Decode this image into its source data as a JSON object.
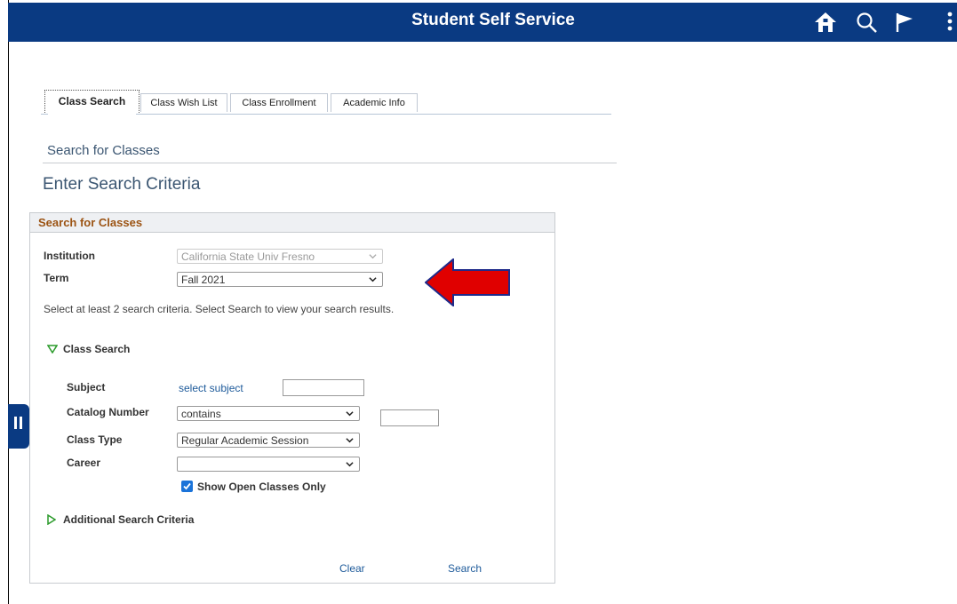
{
  "header": {
    "title": "Student Self Service"
  },
  "icons": {
    "home": "home-icon",
    "search": "search-icon",
    "flag": "flag-icon",
    "menu": "kebab-menu-icon"
  },
  "tabs": [
    {
      "label": "Class Search",
      "active": true
    },
    {
      "label": "Class Wish List",
      "active": false
    },
    {
      "label": "Class Enrollment",
      "active": false
    },
    {
      "label": "Academic Info",
      "active": false
    }
  ],
  "page": {
    "title": "Search for Classes",
    "section_title": "Enter Search Criteria"
  },
  "search_box": {
    "header": "Search for Classes",
    "institution_label": "Institution",
    "institution_value": "California State Univ  Fresno",
    "term_label": "Term",
    "term_value": "Fall 2021",
    "instructions": "Select at least 2 search criteria. Select Search to view your search results.",
    "class_search_label": "Class Search",
    "subject_label": "Subject",
    "subject_link": "select subject",
    "catalog_label": "Catalog Number",
    "catalog_operator": "contains",
    "class_type_label": "Class Type",
    "class_type_value": "Regular Academic Session",
    "career_label": "Career",
    "career_value": "",
    "open_only_label": "Show Open Classes Only",
    "open_only_checked": true,
    "additional_label": "Additional Search Criteria",
    "clear_label": "Clear",
    "search_label": "Search"
  },
  "colors": {
    "header_bg": "#0a3a82",
    "box_title": "#9c5414",
    "link": "#1d5a9a",
    "arrow": "#e00000"
  }
}
